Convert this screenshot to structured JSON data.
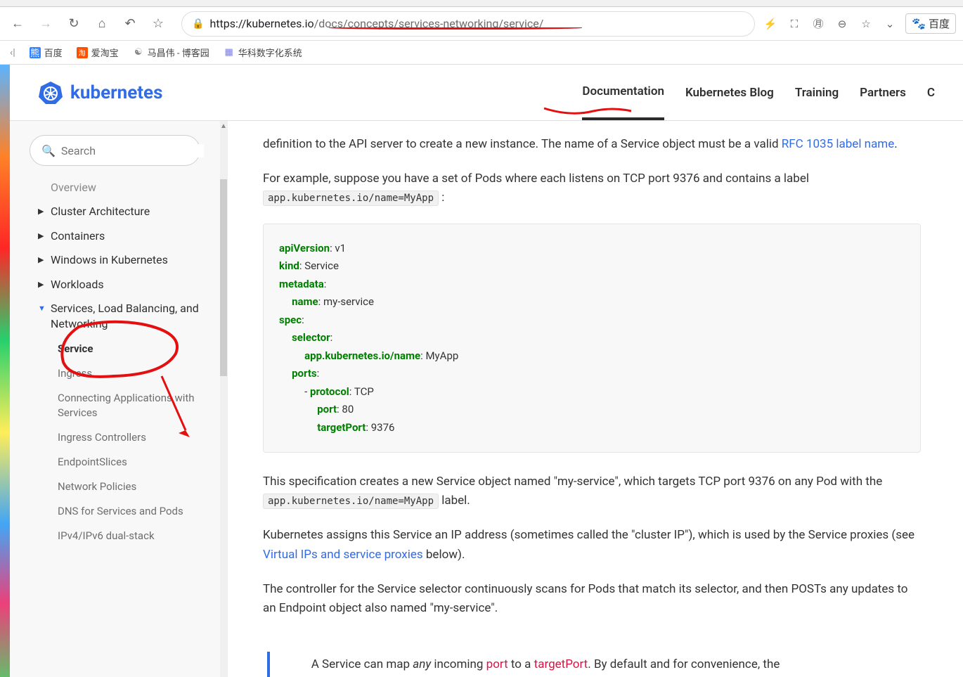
{
  "browser": {
    "url_domain": "https://kubernetes.io",
    "url_path": "/docs/concepts/services-networking/service/",
    "ext_label": "百度"
  },
  "bookmarks": {
    "b1": "百度",
    "b2": "爱淘宝",
    "b3": "马昌伟 - 博客园",
    "b4": "华科数字化系统"
  },
  "header": {
    "logo": "kubernetes",
    "nav": {
      "documentation": "Documentation",
      "blog": "Kubernetes Blog",
      "training": "Training",
      "partners": "Partners",
      "community": "C"
    }
  },
  "sidebar": {
    "search_placeholder": "Search",
    "items": {
      "overview": "Overview",
      "cluster": "Cluster Architecture",
      "containers": "Containers",
      "windows": "Windows in Kubernetes",
      "workloads": "Workloads",
      "services_lb": "Services, Load Balancing, and Networking"
    },
    "sub": {
      "service": "Service",
      "ingress": "Ingress",
      "connecting": "Connecting Applications with Services",
      "ingress_ctrl": "Ingress Controllers",
      "endpointslices": "EndpointSlices",
      "netpol": "Network Policies",
      "dns": "DNS for Services and Pods",
      "dualstack": "IPv4/IPv6 dual-stack"
    }
  },
  "content": {
    "p1a": "definition to the API server to create a new instance. The name of a Service object must be a valid ",
    "p1_link": "RFC 1035 label name",
    "p1b": ".",
    "p2a": "For example, suppose you have a set of Pods where each listens on TCP port 9376 and contains a label ",
    "p2_code": "app.kubernetes.io/name=MyApp",
    "p2b": " :",
    "code": {
      "apiVersion_k": "apiVersion",
      "apiVersion_v": ": v1",
      "kind_k": "kind",
      "kind_v": ": Service",
      "metadata_k": "metadata",
      "metadata_colon": ":",
      "name_k": "name",
      "name_v": ": my-service",
      "spec_k": "spec",
      "spec_colon": ":",
      "selector_k": "selector",
      "selector_colon": ":",
      "applabel_k": "app.kubernetes.io/name",
      "applabel_v": ": MyApp",
      "ports_k": "ports",
      "ports_colon": ":",
      "dash": "- ",
      "protocol_k": "protocol",
      "protocol_v": ": TCP",
      "port_k": "port",
      "port_v": ": 80",
      "targetPort_k": "targetPort",
      "targetPort_v": ": 9376"
    },
    "p3a": "This specification creates a new Service object named \"my-service\", which targets TCP port 9376 on any Pod with the ",
    "p3_code": "app.kubernetes.io/name=MyApp",
    "p3b": " label.",
    "p4a": "Kubernetes assigns this Service an IP address (sometimes called the \"cluster IP\"), which is used by the Service proxies (see ",
    "p4_link": "Virtual IPs and service proxies",
    "p4b": " below).",
    "p5": "The controller for the Service selector continuously scans for Pods that match its selector, and then POSTs any updates to an Endpoint object also named \"my-service\".",
    "note_a": "A Service can map ",
    "note_em": "any",
    "note_b": " incoming ",
    "note_c1": "port",
    "note_c": " to a ",
    "note_c2": "targetPort",
    "note_d": ". By default and for convenience, the"
  }
}
